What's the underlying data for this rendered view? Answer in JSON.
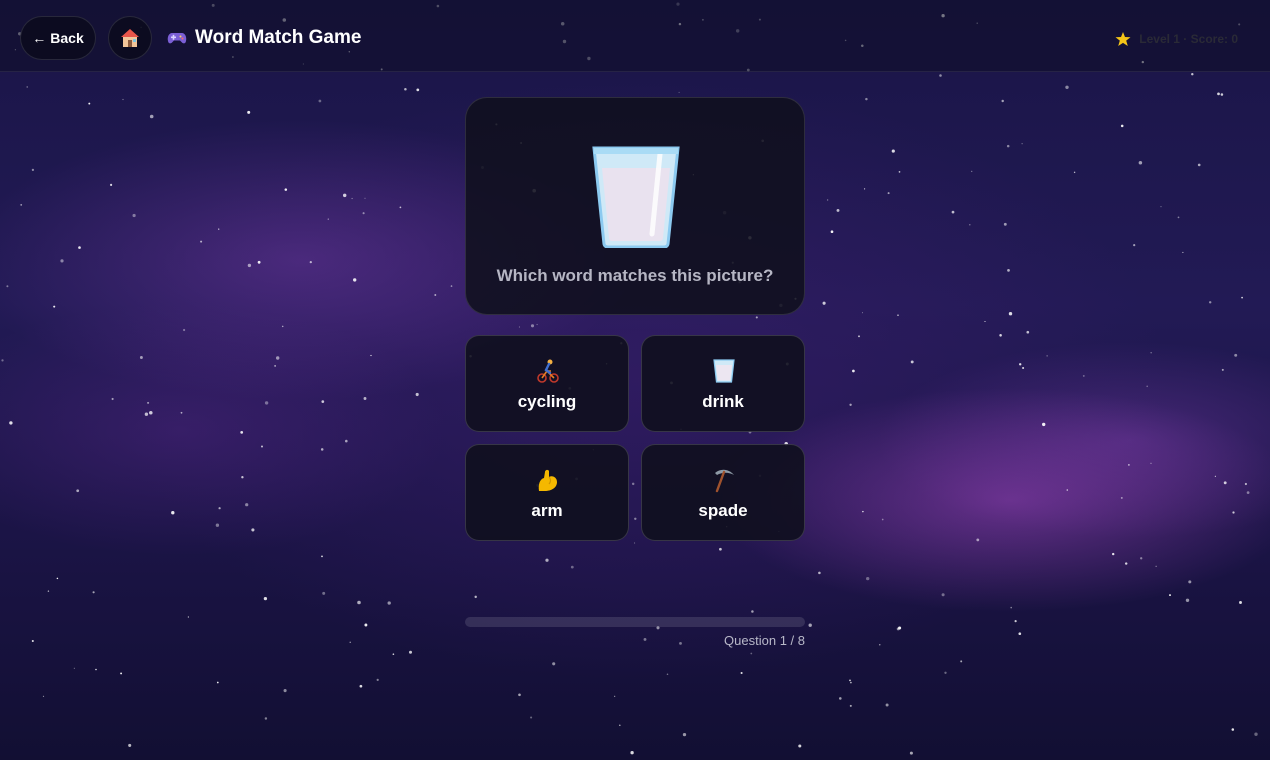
{
  "header": {
    "back_arrow": "←",
    "back_label": "Back",
    "home_icon": "house-icon",
    "game_icon": "gamepad-icon",
    "title": "Word Match Game",
    "level_icon": "star-icon",
    "level_text": "Level 1 · Score: 0"
  },
  "question": {
    "image_icon": "glass-of-milk-icon",
    "prompt": "Which word matches this picture?"
  },
  "options": [
    {
      "label": "cycling",
      "icon": "cyclist-icon"
    },
    {
      "label": "drink",
      "icon": "glass-of-milk-icon"
    },
    {
      "label": "arm",
      "icon": "flexed-biceps-icon"
    },
    {
      "label": "spade",
      "icon": "pick-icon"
    }
  ],
  "progress": {
    "text": "Question 1 / 8",
    "fraction": 0
  },
  "colors": {
    "accent": "#8b7cf6",
    "star": "#f5c518"
  }
}
